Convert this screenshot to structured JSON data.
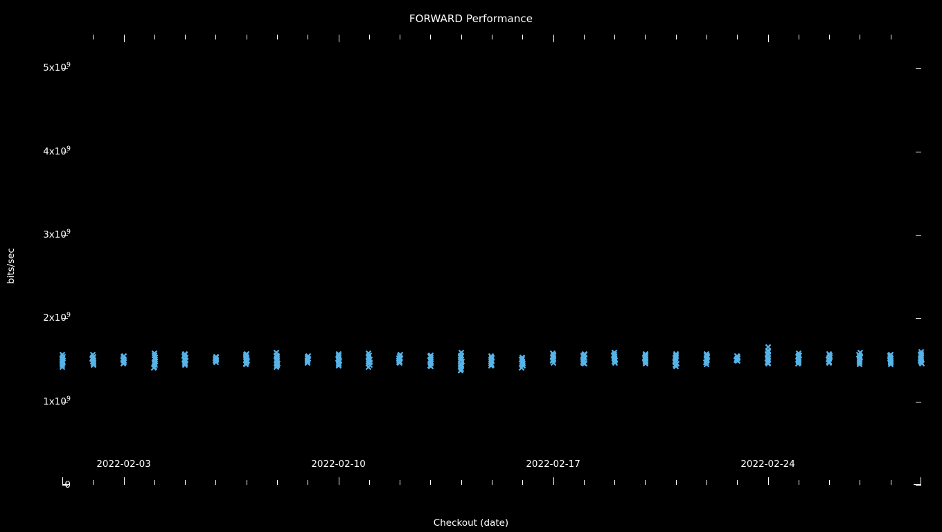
{
  "chart_data": {
    "type": "scatter",
    "title": "FORWARD Performance",
    "xlabel": "Checkout (date)",
    "ylabel": "bits/sec",
    "grid": false,
    "legend": null,
    "marker": "x",
    "marker_color": "#56B4E9",
    "background_color": "#000000",
    "foreground_color": "#FFFFFF",
    "xlim": [
      "2022-02-01",
      "2022-02-29"
    ],
    "ylim": [
      0,
      5400000000
    ],
    "ytick_labels": [
      "0",
      "1x10⁹",
      "2x10⁹",
      "3x10⁹",
      "4x10⁹",
      "5x10⁹"
    ],
    "ytick_values": [
      0,
      1000000000,
      2000000000,
      3000000000,
      4000000000,
      5000000000
    ],
    "ytick_mantissas": [
      "0",
      "1x10",
      "2x10",
      "3x10",
      "4x10",
      "5x10"
    ],
    "ytick_exponents": [
      "",
      "9",
      "9",
      "9",
      "9",
      "9"
    ],
    "xtick_labels": [
      "2022-02-03",
      "2022-02-10",
      "2022-02-17",
      "2022-02-24"
    ],
    "xtick_dates": [
      "2022-02-03",
      "2022-02-10",
      "2022-02-17",
      "2022-02-24"
    ],
    "x_minor_count": 28,
    "series": [
      {
        "name": "FORWARD",
        "points": [
          {
            "date": "2022-02-01",
            "low": 1420000000,
            "high": 1560000000,
            "n": 9
          },
          {
            "date": "2022-02-02",
            "low": 1440000000,
            "high": 1555000000,
            "n": 9
          },
          {
            "date": "2022-02-03",
            "low": 1455000000,
            "high": 1545000000,
            "n": 8
          },
          {
            "date": "2022-02-04",
            "low": 1405000000,
            "high": 1570000000,
            "n": 11
          },
          {
            "date": "2022-02-05",
            "low": 1435000000,
            "high": 1570000000,
            "n": 10
          },
          {
            "date": "2022-02-06",
            "low": 1470000000,
            "high": 1540000000,
            "n": 7
          },
          {
            "date": "2022-02-07",
            "low": 1440000000,
            "high": 1575000000,
            "n": 10
          },
          {
            "date": "2022-02-08",
            "low": 1405000000,
            "high": 1580000000,
            "n": 12
          },
          {
            "date": "2022-02-09",
            "low": 1465000000,
            "high": 1545000000,
            "n": 8
          },
          {
            "date": "2022-02-10",
            "low": 1430000000,
            "high": 1565000000,
            "n": 10
          },
          {
            "date": "2022-02-11",
            "low": 1420000000,
            "high": 1575000000,
            "n": 11
          },
          {
            "date": "2022-02-12",
            "low": 1455000000,
            "high": 1555000000,
            "n": 8
          },
          {
            "date": "2022-02-13",
            "low": 1420000000,
            "high": 1555000000,
            "n": 10
          },
          {
            "date": "2022-02-14",
            "low": 1370000000,
            "high": 1580000000,
            "n": 13
          },
          {
            "date": "2022-02-15",
            "low": 1425000000,
            "high": 1545000000,
            "n": 9
          },
          {
            "date": "2022-02-16",
            "low": 1405000000,
            "high": 1530000000,
            "n": 9
          },
          {
            "date": "2022-02-17",
            "low": 1470000000,
            "high": 1580000000,
            "n": 9
          },
          {
            "date": "2022-02-18",
            "low": 1450000000,
            "high": 1575000000,
            "n": 10
          },
          {
            "date": "2022-02-19",
            "low": 1465000000,
            "high": 1595000000,
            "n": 10
          },
          {
            "date": "2022-02-20",
            "low": 1450000000,
            "high": 1570000000,
            "n": 9
          },
          {
            "date": "2022-02-21",
            "low": 1420000000,
            "high": 1570000000,
            "n": 11
          },
          {
            "date": "2022-02-22",
            "low": 1450000000,
            "high": 1570000000,
            "n": 10
          },
          {
            "date": "2022-02-23",
            "low": 1480000000,
            "high": 1545000000,
            "n": 6
          },
          {
            "date": "2022-02-24",
            "low": 1440000000,
            "high": 1660000000,
            "n": 13
          },
          {
            "date": "2022-02-25",
            "low": 1450000000,
            "high": 1575000000,
            "n": 10
          },
          {
            "date": "2022-02-26",
            "low": 1455000000,
            "high": 1565000000,
            "n": 9
          },
          {
            "date": "2022-02-27",
            "low": 1450000000,
            "high": 1580000000,
            "n": 10
          },
          {
            "date": "2022-02-28",
            "low": 1440000000,
            "high": 1565000000,
            "n": 10
          },
          {
            "date": "2022-03-01",
            "low": 1460000000,
            "high": 1590000000,
            "n": 10
          }
        ]
      }
    ],
    "notes": "Dense clusters of x-shaped markers around 1.4-1.6x10^9 bits/sec; one higher outlier near 2022-02-24 at approximately 1.66x10^9."
  }
}
